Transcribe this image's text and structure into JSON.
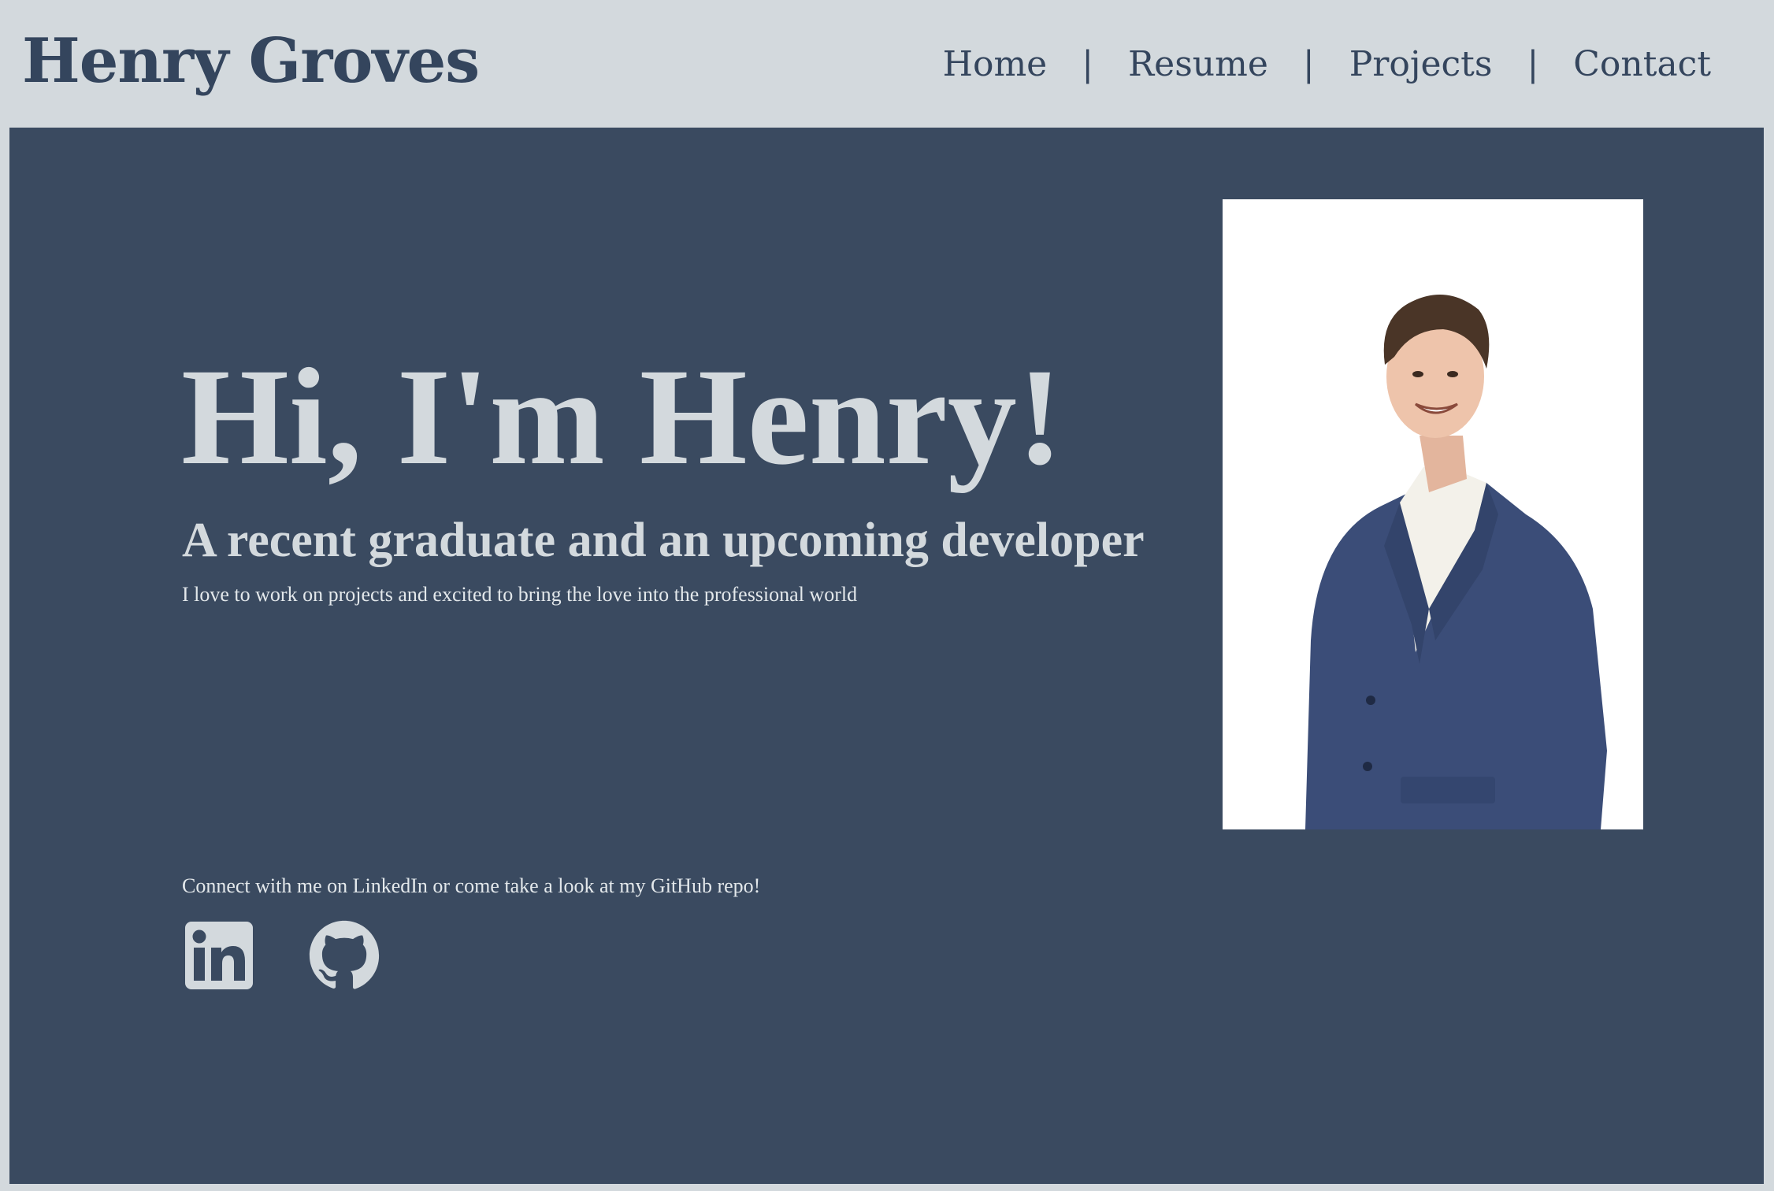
{
  "header": {
    "site_title": "Henry Groves",
    "nav": [
      {
        "label": "Home"
      },
      {
        "label": "Resume"
      },
      {
        "label": "Projects"
      },
      {
        "label": "Contact"
      }
    ],
    "separator": "|"
  },
  "hero": {
    "heading": "Hi, I'm Henry!",
    "subheading": "A recent graduate and an upcoming developer",
    "tagline": "I love to work on projects and excited to bring the love into the professional world",
    "connect_text": "Connect with me on LinkedIn or come take a look at my GitHub repo!",
    "social": [
      {
        "icon": "linkedin-icon"
      },
      {
        "icon": "github-icon"
      }
    ]
  },
  "colors": {
    "header_bg": "#d3d9dd",
    "hero_bg": "#3a4a60",
    "title_text": "#34455d",
    "light_text": "#d3d9dd"
  }
}
